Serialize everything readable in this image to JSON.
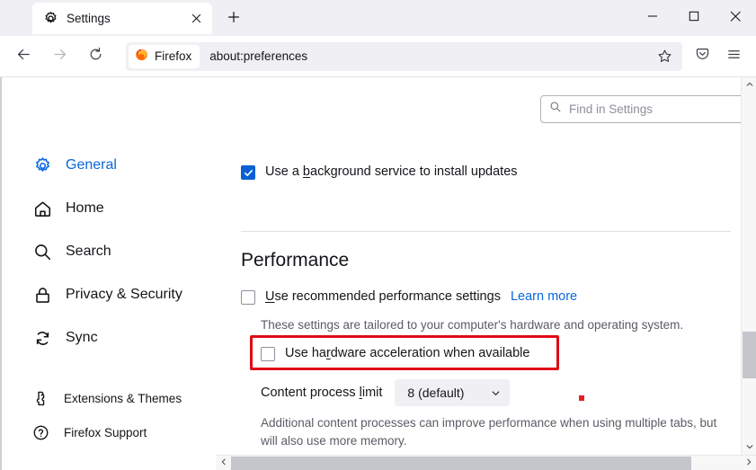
{
  "window": {
    "minimize_label": "Minimize",
    "maximize_label": "Maximize",
    "close_label": "Close"
  },
  "tabs": {
    "active": {
      "title": "Settings",
      "favicon": "gear-icon",
      "close_label": "Close tab"
    },
    "new_tab_label": "New tab"
  },
  "toolbar": {
    "back_label": "Back",
    "forward_label": "Forward",
    "reload_label": "Reload",
    "identity_chip": "Firefox",
    "url": "about:preferences",
    "bookmark_label": "Bookmark this page",
    "pocket_label": "Save to Pocket",
    "menu_label": "Open application menu"
  },
  "search": {
    "placeholder": "Find in Settings",
    "icon": "search-icon"
  },
  "sidebar": {
    "items": [
      {
        "label": "General",
        "icon": "gear-icon",
        "active": true
      },
      {
        "label": "Home",
        "icon": "home-icon",
        "active": false
      },
      {
        "label": "Search",
        "icon": "search-icon",
        "active": false
      },
      {
        "label": "Privacy & Security",
        "icon": "lock-icon",
        "active": false
      },
      {
        "label": "Sync",
        "icon": "sync-icon",
        "active": false
      }
    ],
    "footer_items": [
      {
        "label": "Extensions & Themes",
        "icon": "puzzle-icon"
      },
      {
        "label": "Firefox Support",
        "icon": "question-circle-icon"
      }
    ]
  },
  "main": {
    "background_update": {
      "label_before": "Use a ",
      "accesskey": "b",
      "label_after": "ackground service to install updates",
      "checked": true
    },
    "performance": {
      "heading": "Performance",
      "recommended": {
        "label_before": "",
        "accesskey": "U",
        "label_after": "se recommended performance settings",
        "checked": false,
        "learn_more": "Learn more"
      },
      "tailored_note": "These settings are tailored to your computer's hardware and operating system.",
      "hardware_accel": {
        "label_before": "Use ha",
        "accesskey": "r",
        "label_after": "dware acceleration when available",
        "checked": false,
        "highlighted": true
      },
      "content_process": {
        "label_before": "Content process ",
        "accesskey": "l",
        "label_after": "imit",
        "value": "8 (default)",
        "chevron": "chevron-down-icon"
      },
      "process_note_line1": "Additional content processes can improve performance when using multiple tabs, but",
      "process_note_line2": "will also use more memory."
    }
  },
  "colors": {
    "accent_blue": "#0a66dd",
    "checkbox_blue": "#0a5fd6",
    "highlight_red": "#e00b17",
    "marker_red": "#e41f26",
    "chrome_gray": "#f0f0f4"
  },
  "scrollbars": {
    "vertical": {
      "up_label": "Scroll up",
      "down_label": "Scroll down"
    },
    "horizontal": {
      "left_label": "Scroll left",
      "right_label": "Scroll right"
    }
  }
}
